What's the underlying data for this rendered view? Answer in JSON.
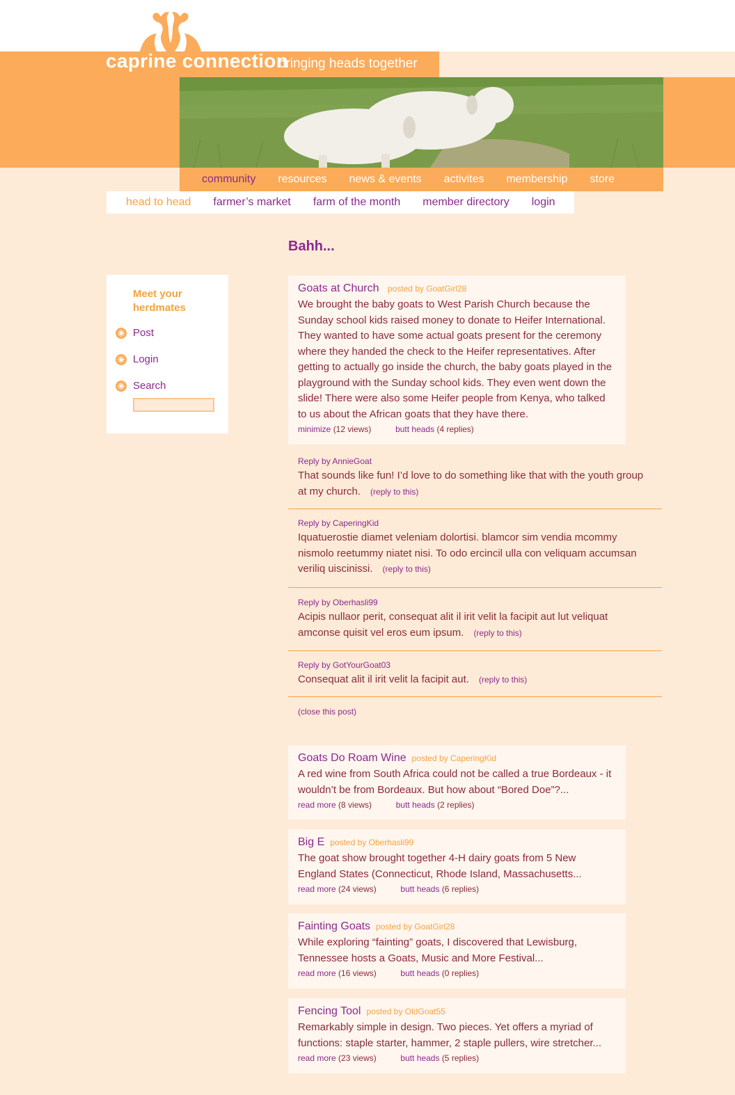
{
  "site": {
    "title": "caprine connection",
    "tagline": "bringing heads together",
    "logo_icon": "goat-logo-icon"
  },
  "colors": {
    "orange": "#fbab5a",
    "cream": "#fdebd8",
    "purple": "#8b2a8f",
    "text": "#8b2a3a"
  },
  "main_nav": [
    {
      "label": "community",
      "active": true
    },
    {
      "label": "resources"
    },
    {
      "label": "news & events"
    },
    {
      "label": "activites"
    },
    {
      "label": "membership"
    },
    {
      "label": "store"
    }
  ],
  "sub_nav": [
    {
      "label": "head to head",
      "active": true
    },
    {
      "label": "farmer’s market"
    },
    {
      "label": "farm of the month"
    },
    {
      "label": "member directory"
    },
    {
      "label": "login"
    }
  ],
  "page_heading": "Bahh...",
  "sidebar": {
    "heading": "Meet your herdmates",
    "links": [
      "Post",
      "Login",
      "Search"
    ],
    "bullet_icon": "flower-bullet-icon"
  },
  "open_post": {
    "title": "Goats at Church",
    "byline": "posted by GoatGirl28",
    "body": "We brought the baby goats to West Parish Church because the Sunday school kids raised money to donate to Heifer International. They wanted to have some actual goats present for the ceremony where they handed the check to the Heifer representatives. After getting to actually go inside the church, the baby goats played in the playground with the Sunday school kids. They even went down the slide! There were also some Heifer people from Kenya, who talked to us about the African goats that they have there.",
    "action_label": "minimize",
    "views": "(12 views)",
    "butt_heads": "butt heads",
    "replies": "(4 replies)"
  },
  "replies": [
    {
      "by": "Reply by AnnieGoat",
      "text": "That sounds like fun! I’d love to do something like that with the youth group at my church.",
      "link": "(reply to this)"
    },
    {
      "by": "Reply by CaperingKid",
      "text": "Iquatuerostie diamet veleniam dolortisi. blamcor sim vendia mcommy nismolo reetummy niatet nisi. To odo ercincil ulla con veliquam accumsan veriliq uiscinissi.",
      "link": "(reply to this)"
    },
    {
      "by": "Reply by Oberhasli99",
      "text": "Acipis nullaor perit, consequat alit il irit velit la facipit aut lut veliquat amconse quisit vel eros eum ipsum.",
      "link": "(reply to this)"
    },
    {
      "by": "Reply by GotYourGoat03",
      "text": "Consequat alit il irit velit la facipit aut.",
      "link": "(reply to this)"
    }
  ],
  "close_label": "(close this post)",
  "posts": [
    {
      "title": "Goats Do Roam Wine",
      "byline": "posted by CaperingKid",
      "body": "A red wine from South Africa could not be called a true Bordeaux - it wouldn’t be from Bordeaux. But how about “Bored Doe”?...",
      "action": "read more",
      "views": "(8 views)",
      "butt_heads": "butt heads",
      "replies": "(2 replies)"
    },
    {
      "title": "Big E",
      "byline": "posted by Oberhasli99",
      "body": "The goat show brought together 4-H dairy goats from 5 New England States (Connecticut, Rhode Island, Massachusetts...",
      "action": "read more",
      "views": "(24 views)",
      "butt_heads": "butt heads",
      "replies": "(6 replies)"
    },
    {
      "title": "Fainting Goats",
      "byline": "posted by GoatGirl28",
      "body": "While exploring “fainting” goats, I discovered that Lewisburg, Tennessee hosts a Goats, Music and More Festival...",
      "action": "read more",
      "views": "(16 views)",
      "butt_heads": "butt heads",
      "replies": "(0 replies)"
    },
    {
      "title": "Fencing Tool",
      "byline": "posted by OldGoat55",
      "body": "Remarkably simple in design. Two pieces. Yet offers a myriad of functions: staple starter, hammer, 2 staple pullers, wire stretcher...",
      "action": "read more",
      "views": "(23 views)",
      "butt_heads": "butt heads",
      "replies": "(5 replies)"
    }
  ]
}
